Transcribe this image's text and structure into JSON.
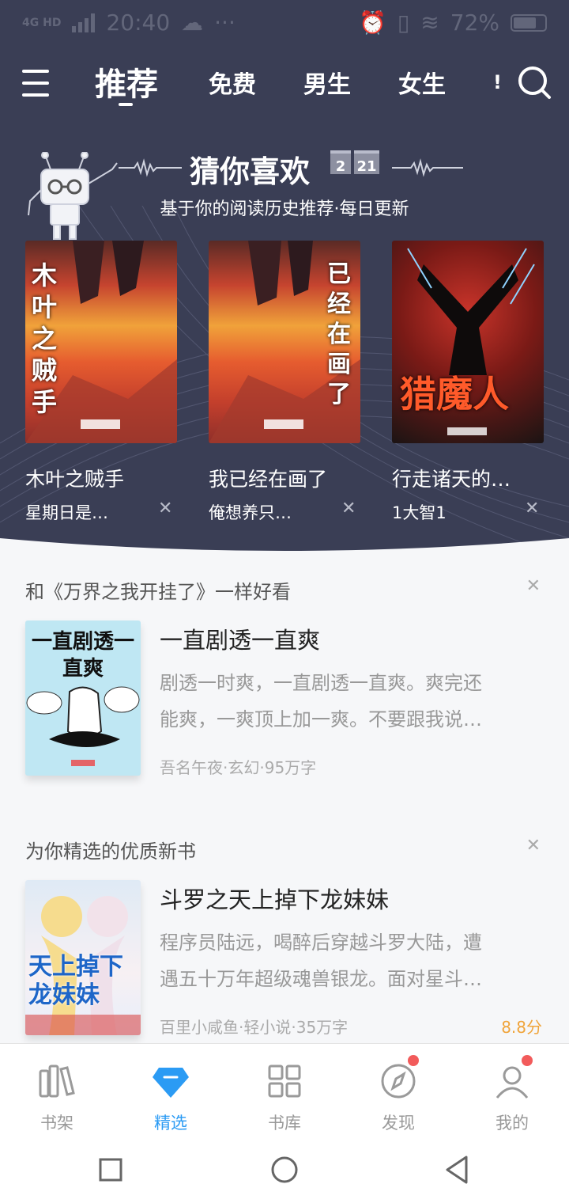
{
  "status_bar": {
    "network": "4G HD",
    "time": "20:40",
    "battery": "72%"
  },
  "top_nav": {
    "tabs": [
      {
        "label": "推荐",
        "active": true
      },
      {
        "label": "免费"
      },
      {
        "label": "男生"
      },
      {
        "label": "女生"
      }
    ]
  },
  "guess": {
    "title": "猜你喜欢",
    "calendar": [
      "2",
      "21"
    ],
    "subtitle": "基于你的阅读历史推荐·每日更新",
    "books": [
      {
        "cover_title": "木叶之贼手",
        "name": "木叶之贼手",
        "author": "星期日是…"
      },
      {
        "cover_title": "已经在画了",
        "name": "我已经在画了",
        "author": "俺想养只…"
      },
      {
        "cover_title": "猎魔人",
        "name": "行走诸天的…",
        "author": "1大智1"
      }
    ]
  },
  "similar": {
    "heading": "和《万界之我开挂了》一样好看",
    "book": {
      "cover_title": "一直剧透一直爽",
      "title": "一直剧透一直爽",
      "desc_line1": "剧透一时爽，一直剧透一直爽。爽完还",
      "desc_line2": "能爽，一爽顶上加一爽。不要跟我说…",
      "meta": "吾名午夜·玄幻·95万字"
    }
  },
  "new_books": {
    "heading": "为你精选的优质新书",
    "book": {
      "cover_title": "天上掉下龙妹妹",
      "title": "斗罗之天上掉下龙妹妹",
      "desc_line1": "程序员陆远，喝醉后穿越斗罗大陆，遭",
      "desc_line2": "遇五十万年超级魂兽银龙。面对星斗…",
      "meta": "百里小咸鱼·轻小说·35万字",
      "score": "8.8分"
    }
  },
  "bottom_nav": [
    {
      "label": "书架",
      "icon": "bookshelf-icon"
    },
    {
      "label": "精选",
      "icon": "diamond-icon",
      "active": true
    },
    {
      "label": "书库",
      "icon": "grid-icon"
    },
    {
      "label": "发现",
      "icon": "compass-icon",
      "badge": true
    },
    {
      "label": "我的",
      "icon": "user-icon",
      "badge": true
    }
  ],
  "colors": {
    "hero_bg": "#3a3e55",
    "accent": "#2b9bf4",
    "score": "#f0a43a",
    "badge": "#f25b5b"
  }
}
